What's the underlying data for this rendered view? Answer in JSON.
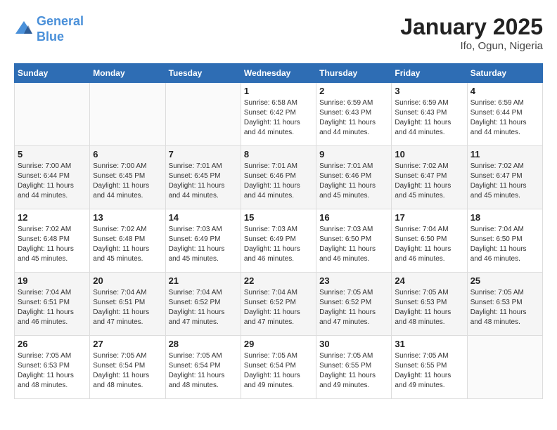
{
  "header": {
    "logo_line1": "General",
    "logo_line2": "Blue",
    "month": "January 2025",
    "location": "Ifo, Ogun, Nigeria"
  },
  "days_of_week": [
    "Sunday",
    "Monday",
    "Tuesday",
    "Wednesday",
    "Thursday",
    "Friday",
    "Saturday"
  ],
  "weeks": [
    [
      {
        "day": "",
        "info": ""
      },
      {
        "day": "",
        "info": ""
      },
      {
        "day": "",
        "info": ""
      },
      {
        "day": "1",
        "info": "Sunrise: 6:58 AM\nSunset: 6:42 PM\nDaylight: 11 hours and 44 minutes."
      },
      {
        "day": "2",
        "info": "Sunrise: 6:59 AM\nSunset: 6:43 PM\nDaylight: 11 hours and 44 minutes."
      },
      {
        "day": "3",
        "info": "Sunrise: 6:59 AM\nSunset: 6:43 PM\nDaylight: 11 hours and 44 minutes."
      },
      {
        "day": "4",
        "info": "Sunrise: 6:59 AM\nSunset: 6:44 PM\nDaylight: 11 hours and 44 minutes."
      }
    ],
    [
      {
        "day": "5",
        "info": "Sunrise: 7:00 AM\nSunset: 6:44 PM\nDaylight: 11 hours and 44 minutes."
      },
      {
        "day": "6",
        "info": "Sunrise: 7:00 AM\nSunset: 6:45 PM\nDaylight: 11 hours and 44 minutes."
      },
      {
        "day": "7",
        "info": "Sunrise: 7:01 AM\nSunset: 6:45 PM\nDaylight: 11 hours and 44 minutes."
      },
      {
        "day": "8",
        "info": "Sunrise: 7:01 AM\nSunset: 6:46 PM\nDaylight: 11 hours and 44 minutes."
      },
      {
        "day": "9",
        "info": "Sunrise: 7:01 AM\nSunset: 6:46 PM\nDaylight: 11 hours and 45 minutes."
      },
      {
        "day": "10",
        "info": "Sunrise: 7:02 AM\nSunset: 6:47 PM\nDaylight: 11 hours and 45 minutes."
      },
      {
        "day": "11",
        "info": "Sunrise: 7:02 AM\nSunset: 6:47 PM\nDaylight: 11 hours and 45 minutes."
      }
    ],
    [
      {
        "day": "12",
        "info": "Sunrise: 7:02 AM\nSunset: 6:48 PM\nDaylight: 11 hours and 45 minutes."
      },
      {
        "day": "13",
        "info": "Sunrise: 7:02 AM\nSunset: 6:48 PM\nDaylight: 11 hours and 45 minutes."
      },
      {
        "day": "14",
        "info": "Sunrise: 7:03 AM\nSunset: 6:49 PM\nDaylight: 11 hours and 45 minutes."
      },
      {
        "day": "15",
        "info": "Sunrise: 7:03 AM\nSunset: 6:49 PM\nDaylight: 11 hours and 46 minutes."
      },
      {
        "day": "16",
        "info": "Sunrise: 7:03 AM\nSunset: 6:50 PM\nDaylight: 11 hours and 46 minutes."
      },
      {
        "day": "17",
        "info": "Sunrise: 7:04 AM\nSunset: 6:50 PM\nDaylight: 11 hours and 46 minutes."
      },
      {
        "day": "18",
        "info": "Sunrise: 7:04 AM\nSunset: 6:50 PM\nDaylight: 11 hours and 46 minutes."
      }
    ],
    [
      {
        "day": "19",
        "info": "Sunrise: 7:04 AM\nSunset: 6:51 PM\nDaylight: 11 hours and 46 minutes."
      },
      {
        "day": "20",
        "info": "Sunrise: 7:04 AM\nSunset: 6:51 PM\nDaylight: 11 hours and 47 minutes."
      },
      {
        "day": "21",
        "info": "Sunrise: 7:04 AM\nSunset: 6:52 PM\nDaylight: 11 hours and 47 minutes."
      },
      {
        "day": "22",
        "info": "Sunrise: 7:04 AM\nSunset: 6:52 PM\nDaylight: 11 hours and 47 minutes."
      },
      {
        "day": "23",
        "info": "Sunrise: 7:05 AM\nSunset: 6:52 PM\nDaylight: 11 hours and 47 minutes."
      },
      {
        "day": "24",
        "info": "Sunrise: 7:05 AM\nSunset: 6:53 PM\nDaylight: 11 hours and 48 minutes."
      },
      {
        "day": "25",
        "info": "Sunrise: 7:05 AM\nSunset: 6:53 PM\nDaylight: 11 hours and 48 minutes."
      }
    ],
    [
      {
        "day": "26",
        "info": "Sunrise: 7:05 AM\nSunset: 6:53 PM\nDaylight: 11 hours and 48 minutes."
      },
      {
        "day": "27",
        "info": "Sunrise: 7:05 AM\nSunset: 6:54 PM\nDaylight: 11 hours and 48 minutes."
      },
      {
        "day": "28",
        "info": "Sunrise: 7:05 AM\nSunset: 6:54 PM\nDaylight: 11 hours and 48 minutes."
      },
      {
        "day": "29",
        "info": "Sunrise: 7:05 AM\nSunset: 6:54 PM\nDaylight: 11 hours and 49 minutes."
      },
      {
        "day": "30",
        "info": "Sunrise: 7:05 AM\nSunset: 6:55 PM\nDaylight: 11 hours and 49 minutes."
      },
      {
        "day": "31",
        "info": "Sunrise: 7:05 AM\nSunset: 6:55 PM\nDaylight: 11 hours and 49 minutes."
      },
      {
        "day": "",
        "info": ""
      }
    ]
  ]
}
